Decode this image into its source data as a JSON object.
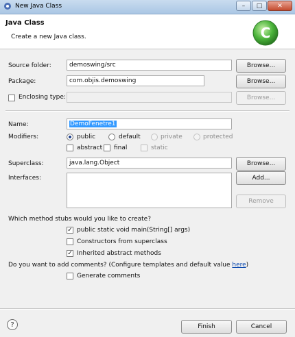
{
  "window": {
    "title": "New Java Class",
    "buttons": {
      "minimize": "–",
      "maximize": "□",
      "close": "✕"
    }
  },
  "banner": {
    "title": "Java Class",
    "description": "Create a new Java class."
  },
  "source_folder": {
    "label": "Source folder:",
    "value": "demoswing/src",
    "browse": "Browse..."
  },
  "package": {
    "label": "Package:",
    "value": "com.objis.demoswing",
    "browse": "Browse..."
  },
  "enclosing": {
    "label": "Enclosing type:",
    "value": "",
    "browse": "Browse..."
  },
  "name": {
    "label": "Name:",
    "value": "DemoFenetre1"
  },
  "modifiers": {
    "label": "Modifiers:",
    "public": "public",
    "default": "default",
    "private": "private",
    "protected": "protected",
    "abstract": "abstract",
    "final": "final",
    "static": "static"
  },
  "superclass": {
    "label": "Superclass:",
    "value": "java.lang.Object",
    "browse": "Browse..."
  },
  "interfaces": {
    "label": "Interfaces:",
    "add": "Add...",
    "remove": "Remove"
  },
  "stubs": {
    "question": "Which method stubs would you like to create?",
    "main": "public static void main(String[] args)",
    "constructors": "Constructors from superclass",
    "inherited": "Inherited abstract methods"
  },
  "comments": {
    "question": "Do you want to add comments? (Configure templates and default value ",
    "link": "here",
    "close_paren": ")",
    "generate": "Generate comments"
  },
  "footer": {
    "help": "?",
    "finish": "Finish",
    "cancel": "Cancel"
  },
  "colors": {
    "accent": "#3399ff",
    "icon_green": "#3aa33a"
  }
}
